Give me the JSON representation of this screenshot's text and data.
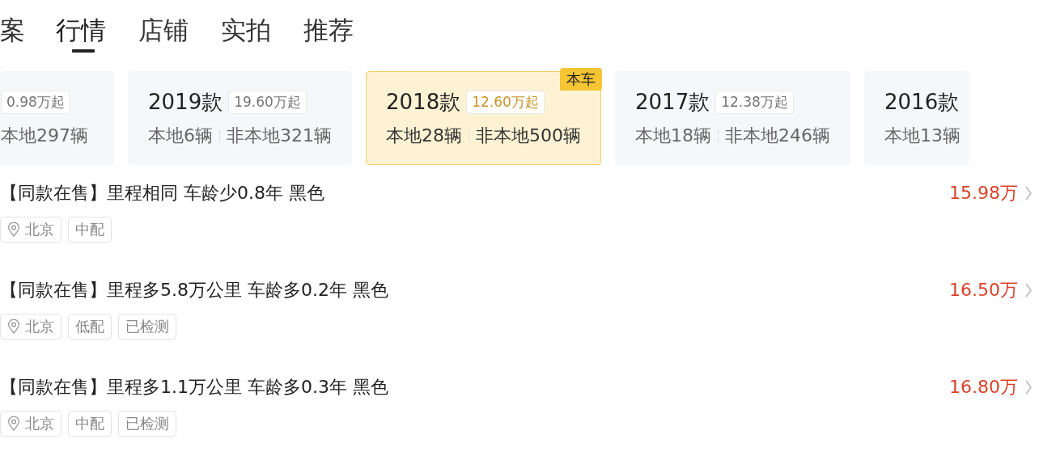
{
  "tabs": [
    {
      "label": "案",
      "selected": false
    },
    {
      "label": "行情",
      "selected": true
    },
    {
      "label": "店铺",
      "selected": false
    },
    {
      "label": "实拍",
      "selected": false
    },
    {
      "label": "推荐",
      "selected": false
    }
  ],
  "model_years": [
    {
      "price": "0.98万起",
      "local": "本地297辆",
      "selected": false
    },
    {
      "year": "2019款",
      "price": "19.60万起",
      "local": "本地6辆",
      "nonlocal": "非本地321辆",
      "selected": false
    },
    {
      "year": "2018款",
      "price": "12.60万起",
      "local": "本地28辆",
      "nonlocal": "非本地500辆",
      "selected": true,
      "badge": "本车"
    },
    {
      "year": "2017款",
      "price": "12.38万起",
      "local": "本地18辆",
      "nonlocal": "非本地246辆",
      "selected": false
    },
    {
      "year": "2016款",
      "local": "本地13辆",
      "selected": false
    }
  ],
  "listings": [
    {
      "title": "【同款在售】里程相同 车龄少0.8年 黑色",
      "city": "北京",
      "tags": [
        "中配"
      ],
      "price": "15.98万"
    },
    {
      "title": "【同款在售】里程多5.8万公里 车龄多0.2年 黑色",
      "city": "北京",
      "tags": [
        "低配",
        "已检测"
      ],
      "price": "16.50万"
    },
    {
      "title": "【同款在售】里程多1.1万公里 车龄多0.3年 黑色",
      "city": "北京",
      "tags": [
        "中配",
        "已检测"
      ],
      "price": "16.80万"
    }
  ]
}
